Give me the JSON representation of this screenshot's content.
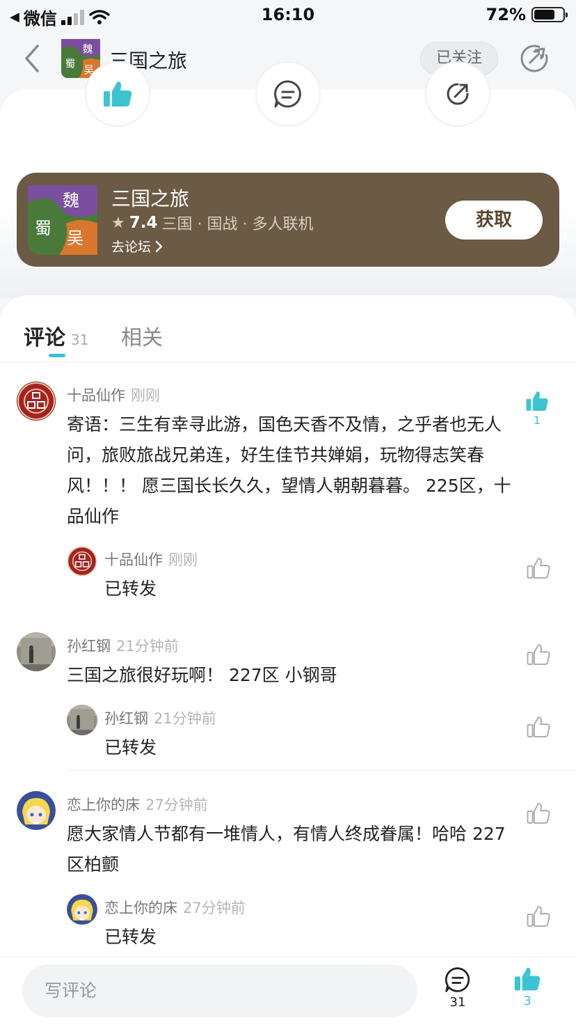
{
  "status_bar": {
    "back_app": "微信",
    "time": "16:10",
    "battery": "72%",
    "battery_level": 0.72
  },
  "nav": {
    "title": "三国之旅",
    "follow_label": "已关注",
    "icon_text": [
      "魏",
      "蜀",
      "吴"
    ]
  },
  "app_card": {
    "title": "三国之旅",
    "rating": "7.4",
    "tags": "三国 · 国战 · 多人联机",
    "forum_link": "去论坛",
    "get_button": "获取"
  },
  "tabs": {
    "comments_label": "评论",
    "comments_count": "31",
    "related_label": "相关"
  },
  "comments": [
    {
      "name": "十品仙作",
      "time": "刚刚",
      "text": "寄语：三生有幸寻此游，国色天香不及情，之乎者也无人问，旅败旅战兄弟连，好生佳节共婵娟，玩物得志笑春风！！！ 愿三国长长久久，望情人朝朝暮暮。 225区，十品仙作",
      "likes": "1",
      "reply": {
        "name": "十品仙作",
        "time": "刚刚",
        "text": "已转发"
      }
    },
    {
      "name": "孙红钢",
      "time": "21分钟前",
      "text": "三国之旅很好玩啊！ 227区 小钢哥",
      "reply": {
        "name": "孙红钢",
        "time": "21分钟前",
        "text": "已转发"
      }
    },
    {
      "name": "恋上你的床",
      "time": "27分钟前",
      "text": "愿大家情人节都有一堆情人，有情人终成眷属！哈哈 227区柏颤",
      "reply": {
        "name": "恋上你的床",
        "time": "27分钟前",
        "text": "已转发"
      }
    }
  ],
  "bottom_bar": {
    "input_placeholder": "写评论",
    "comment_count": "31",
    "like_count": "3"
  },
  "colors": {
    "accent": "#3cc3d4",
    "card_bg": "#6b5a44"
  }
}
